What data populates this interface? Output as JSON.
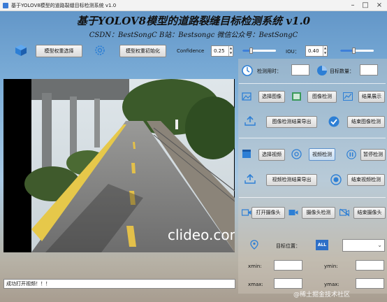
{
  "window": {
    "title": "基于YOLOV8模型的道路裂缝目标检测系统 v1.0"
  },
  "header": {
    "title": "基于YOLOV8模型的道路裂缝目标检测系统 v1.0",
    "subtitle": "CSDN：BestSongC   B站：Bestsongc   微信公众号：BestSongC"
  },
  "toolbar": {
    "select_weight": "模型权重选择",
    "init_weight": "模型权重初始化",
    "confidence_label": "Confidence",
    "confidence_value": "0.25",
    "confidence_level": 0.25,
    "iou_label": "IOU：",
    "iou_value": "0.40",
    "iou_level": 0.4
  },
  "stats": {
    "time_label": "检测用时：",
    "time_value": "",
    "count_label": "目标数量：",
    "count_value": ""
  },
  "image_section": {
    "select_image": "选择图像",
    "detect_image": "图像检测",
    "show_result": "结果展示",
    "export_image_result": "图像检测结果导出",
    "stop_image": "结束图像检测"
  },
  "video_section": {
    "select_video": "选择视频",
    "detect_video": "视频检测",
    "pause": "暂停检测",
    "export_video_result": "视频检测结果导出",
    "stop_video": "结束视频检测"
  },
  "camera_section": {
    "open_camera": "打开摄像头",
    "detect_camera": "摄像头检测",
    "close_camera": "结束摄像头"
  },
  "target": {
    "position_label": "目标位置：",
    "all_badge": "ALL",
    "select_value": "",
    "xmin_label": "xmin:",
    "ymin_label": "ymin:",
    "xmax_label": "xmax:",
    "ymax_label": "ymax:"
  },
  "video": {
    "watermark": "clideo.com"
  },
  "status": {
    "message": "成功打开视频！！！"
  },
  "page_watermark": "@稀土掘金技术社区",
  "colors": {
    "accent": "#3d7fd9",
    "title": "#111111"
  }
}
